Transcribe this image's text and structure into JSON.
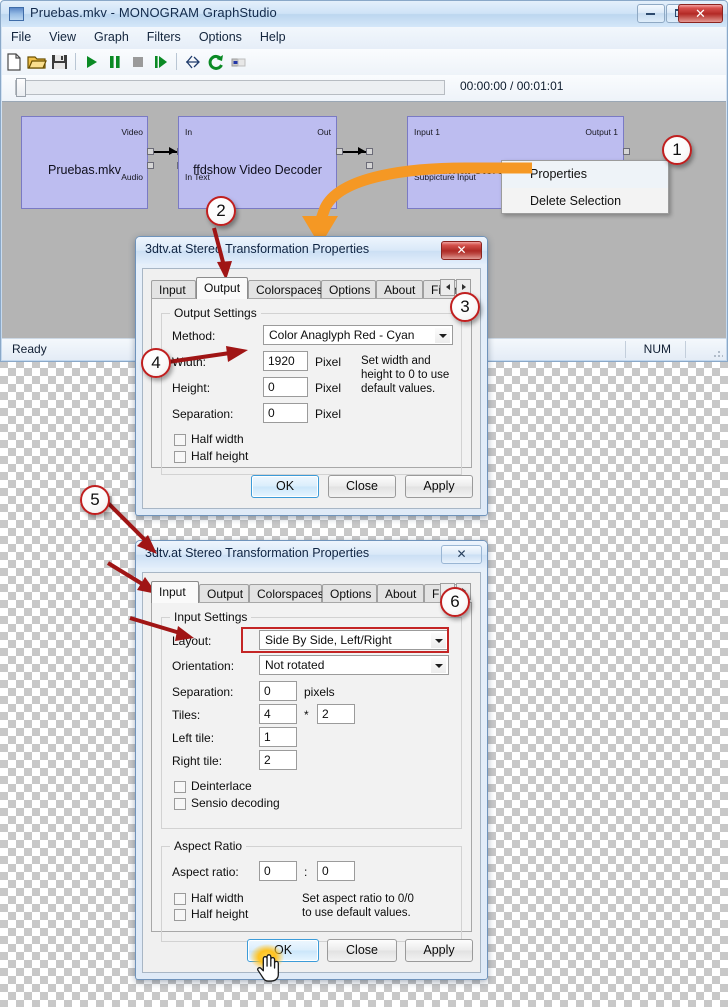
{
  "main_window": {
    "title": "Pruebas.mkv - MONOGRAM GraphStudio",
    "icon": "app-icon",
    "window_buttons": {
      "minimize": "minimize-icon",
      "maximize": "maximize-icon",
      "close": "✕"
    },
    "menus": [
      "File",
      "View",
      "Graph",
      "Filters",
      "Options",
      "Help"
    ],
    "toolbar_icons": [
      "new-file-icon",
      "open-folder-icon",
      "save-icon",
      "play-icon",
      "pause-icon",
      "stop-icon",
      "step-frame-icon",
      "connect-graph-icon",
      "refresh-icon",
      "seek-mode-icon"
    ],
    "time_label": "00:00:00 / 00:01:01",
    "status": {
      "left": "Ready",
      "num": "NUM"
    }
  },
  "graph": {
    "nodes": [
      {
        "name": "Pruebas.mkv",
        "out_pins": [
          "Video",
          "Audio"
        ],
        "in_pins": []
      },
      {
        "name": "ffdshow Video Decoder",
        "in_pins": [
          "In",
          "In Text"
        ],
        "out_pins": [
          "Out"
        ]
      },
      {
        "name": "3dtv.at Stereo Transformation",
        "in_pins": [
          "Input 1",
          "Subpicture Input"
        ],
        "out_pins": [
          "Output 1"
        ]
      }
    ]
  },
  "context_menu": {
    "items": [
      "Properties",
      "Delete Selection"
    ],
    "highlighted": "Properties"
  },
  "dialog_output": {
    "title": "3dtv.at Stereo Transformation Properties",
    "close_label": "✕",
    "tabs": [
      "Input",
      "Output",
      "Colorspaces",
      "Options",
      "About",
      "Filter"
    ],
    "selected_tab": "Output",
    "tab_nav": {
      "left": "prev-tab-icon",
      "right": "next-tab-icon"
    },
    "group_label": "Output Settings",
    "fields": {
      "method_label": "Method:",
      "method_value": "Color Anaglyph Red - Cyan",
      "width_label": "Width:",
      "width_value": "1920",
      "width_unit": "Pixel",
      "height_label": "Height:",
      "height_value": "0",
      "height_unit": "Pixel",
      "separation_label": "Separation:",
      "separation_value": "0",
      "separation_unit": "Pixel",
      "hint": "Set width and\nheight to 0 to use\ndefault values.",
      "half_width": "Half width",
      "half_height": "Half height"
    },
    "buttons": {
      "ok": "OK",
      "close": "Close",
      "apply": "Apply"
    }
  },
  "dialog_input": {
    "title": "3dtv.at Stereo Transformation Properties",
    "close_label": "✕",
    "tabs": [
      "Input",
      "Output",
      "Colorspaces",
      "Options",
      "About",
      "Filter"
    ],
    "selected_tab": "Input",
    "tab_nav": {
      "left": "prev-tab-icon",
      "right": "next-tab-icon"
    },
    "group_input_label": "Input Settings",
    "group_aspect_label": "Aspect Ratio",
    "fields": {
      "layout_label": "Layout:",
      "layout_value": "Side By Side, Left/Right",
      "orientation_label": "Orientation:",
      "orientation_value": "Not rotated",
      "separation_label": "Separation:",
      "separation_value": "0",
      "separation_unit": "pixels",
      "tiles_label": "Tiles:",
      "tiles_x": "4",
      "tiles_sep": "*",
      "tiles_y": "2",
      "left_tile_label": "Left tile:",
      "left_tile_value": "1",
      "right_tile_label": "Right tile:",
      "right_tile_value": "2",
      "deinterlace": "Deinterlace",
      "sensio": "Sensio decoding",
      "aspect_label": "Aspect ratio:",
      "aspect_w": "0",
      "aspect_colon": ":",
      "aspect_h": "0",
      "half_width": "Half width",
      "half_height": "Half height",
      "aspect_hint": "Set aspect ratio to 0/0\nto use default values."
    },
    "buttons": {
      "ok": "OK",
      "close": "Close",
      "apply": "Apply"
    }
  },
  "callouts": [
    {
      "number": "1"
    },
    {
      "number": "2"
    },
    {
      "number": "3"
    },
    {
      "number": "4"
    },
    {
      "number": "5"
    },
    {
      "number": "6"
    }
  ],
  "colors": {
    "callout_ring": "#c01f1f",
    "arrow_red": "#a01515",
    "highlight_orange": "#f59824",
    "highlight_box": "#c42525",
    "node_fill": "#bdbdf0",
    "canvas": "#b4b4b4"
  }
}
